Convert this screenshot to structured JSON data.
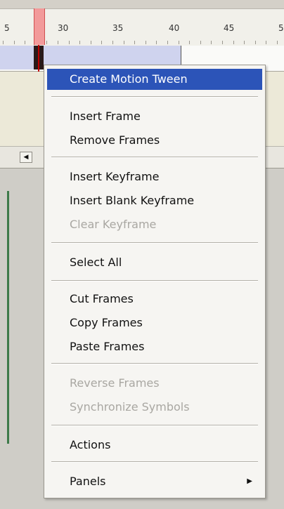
{
  "timeline": {
    "ruler_numbers": [
      "5",
      "30",
      "35",
      "40",
      "45",
      "5"
    ]
  },
  "scroll": {
    "left_arrow_icon": "scroll-left-arrow-icon"
  },
  "menu": {
    "create_motion_tween": "Create Motion Tween",
    "insert_frame": "Insert Frame",
    "remove_frames": "Remove Frames",
    "insert_keyframe": "Insert Keyframe",
    "insert_blank_keyframe": "Insert Blank Keyframe",
    "clear_keyframe": "Clear Keyframe",
    "select_all": "Select All",
    "cut_frames": "Cut Frames",
    "copy_frames": "Copy Frames",
    "paste_frames": "Paste Frames",
    "reverse_frames": "Reverse Frames",
    "synchronize_symbols": "Synchronize Symbols",
    "actions": "Actions",
    "panels": "Panels",
    "panels_arrow_icon": "submenu-arrow-icon"
  },
  "colors": {
    "highlight": "#2c54b8",
    "playhead": "#f29a9a",
    "tween_span": "#cfd3ee",
    "disabled_text": "#a9a7a2"
  }
}
